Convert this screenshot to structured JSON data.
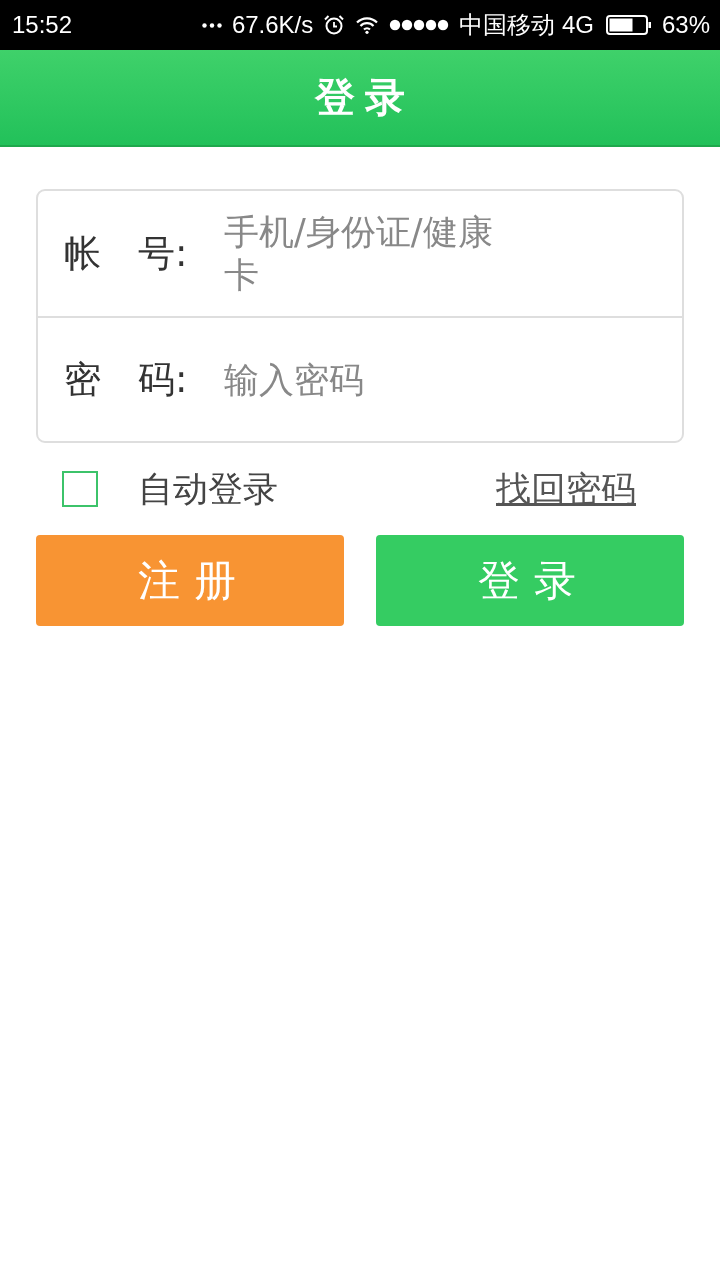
{
  "status_bar": {
    "time": "15:52",
    "network_speed": "67.6K/s",
    "carrier": "中国移动 4G",
    "battery": "63%"
  },
  "header": {
    "title": "登录"
  },
  "form": {
    "fields": [
      {
        "label": "帐　号:",
        "placeholder": "手机/身份证/健康卡",
        "kind": "text"
      },
      {
        "label": "密　码:",
        "placeholder": "输入密码",
        "kind": "password"
      }
    ]
  },
  "auto_login": {
    "label": "自动登录",
    "checked": false
  },
  "forgot_link": "找回密码",
  "buttons": [
    {
      "label": "注册",
      "kind": "secondary"
    },
    {
      "label": "登录",
      "kind": "primary"
    }
  ]
}
